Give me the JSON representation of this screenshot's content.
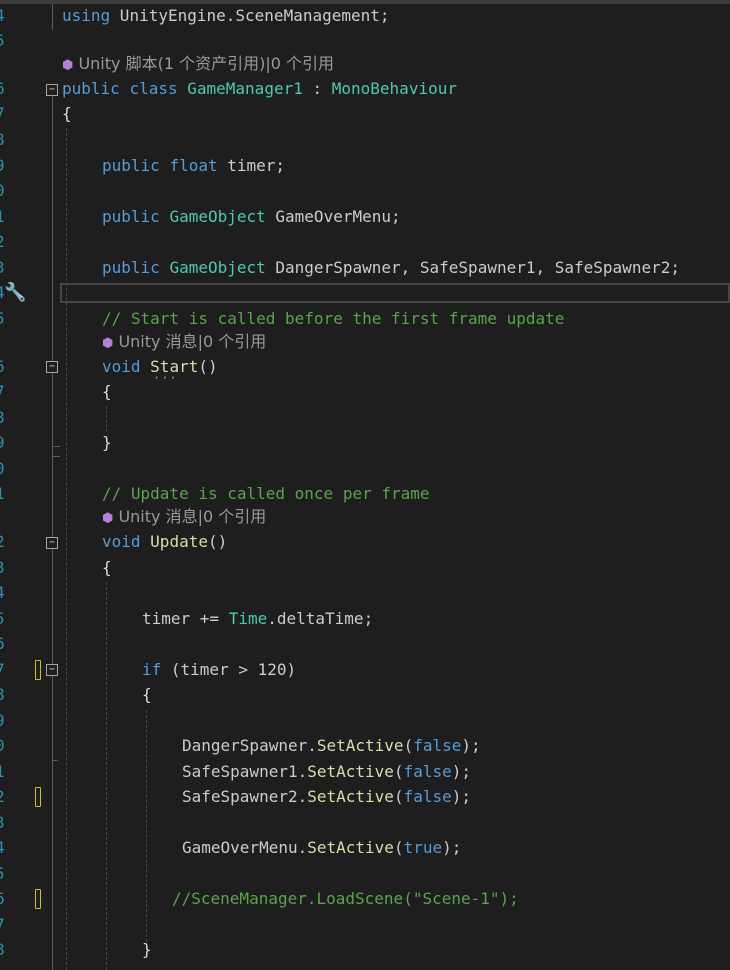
{
  "line_numbers": [
    "4",
    "5",
    "",
    "6",
    "7",
    "8",
    "9",
    "0",
    "1",
    "2",
    "3",
    "4",
    "5",
    "",
    "6",
    "7",
    "8",
    "9",
    "0",
    "1",
    "",
    "2",
    "3",
    "4",
    "5",
    "6",
    "7",
    "8",
    "9",
    "0",
    "1",
    "2",
    "3",
    "4",
    "5",
    "6",
    "7",
    "8"
  ],
  "code": {
    "using_kw": "using",
    "using_ns": " UnityEngine.SceneManagement;",
    "lens_class": "Unity 脚本(1 个资产引用)|0 个引用",
    "class_decl": {
      "public": "public",
      "class": "class",
      "name": "GameManager1",
      "colon": " : ",
      "base": "MonoBehaviour"
    },
    "open_brace": "{",
    "timer_field": {
      "public": "public",
      "type": "float",
      "name": " timer;"
    },
    "gameover_field": {
      "public": "public",
      "type": "GameObject",
      "name": " GameOverMenu;"
    },
    "spawners_field": {
      "public": "public",
      "type": "GameObject",
      "name": " DangerSpawner, SafeSpawner1, SafeSpawner2;"
    },
    "comment_start": "// Start is called before the first frame update",
    "lens_start": "Unity 消息|0 个引用",
    "start_decl": {
      "void": "void",
      "name": "Start",
      "parens": "()"
    },
    "start_open": "{",
    "start_close": "}",
    "comment_update": "// Update is called once per frame",
    "lens_update": "Unity 消息|0 个引用",
    "update_decl": {
      "void": "void",
      "name": "Update",
      "parens": "()"
    },
    "update_open": "{",
    "timer_stmt": {
      "lhs": "timer += ",
      "type": "Time",
      "rhs": ".deltaTime;"
    },
    "if_stmt": {
      "kw": "if",
      "cond": " (timer > 120)"
    },
    "if_open": "{",
    "danger_stmt": {
      "obj": "DangerSpawner.",
      "method": "SetActive",
      "open": "(",
      "arg": "false",
      "close": ");"
    },
    "safe1_stmt": {
      "obj": "SafeSpawner1.",
      "method": "SetActive",
      "open": "(",
      "arg": "false",
      "close": ");"
    },
    "safe2_stmt": {
      "obj": "SafeSpawner2.",
      "method": "SetActive",
      "open": "(",
      "arg": "false",
      "close": ");"
    },
    "gameover_stmt": {
      "obj": "GameOverMenu.",
      "method": "SetActive",
      "open": "(",
      "arg": "true",
      "close": ");"
    },
    "load_comment": "//SceneManager.LoadScene(\"Scene-1\");",
    "if_close": "}"
  },
  "icons": {
    "fold": "collapse-box",
    "lens": "unity-cube",
    "hint": "quick-actions-screwdriver"
  },
  "colors": {
    "bg": "#1e1e1e",
    "keyword": "#569cd6",
    "type": "#4ec9b0",
    "method": "#dcdcaa",
    "comment": "#57a64a",
    "line_number": "#2b91af",
    "change_marker": "#d7ba2c"
  }
}
